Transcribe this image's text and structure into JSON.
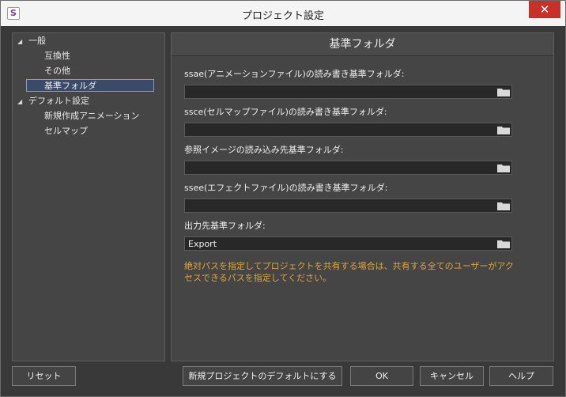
{
  "window": {
    "title": "プロジェクト設定",
    "close_glyph": "✕",
    "app_icon_letter": "S"
  },
  "tree": {
    "items": [
      {
        "label": "一般",
        "expanded_glyph": "◢"
      },
      {
        "label": "互換性"
      },
      {
        "label": "その他"
      },
      {
        "label": "基準フォルダ"
      },
      {
        "label": "デフォルト設定",
        "expanded_glyph": "◢"
      },
      {
        "label": "新規作成アニメーション"
      },
      {
        "label": "セルマップ"
      }
    ]
  },
  "content": {
    "header": "基準フォルダ",
    "fields": [
      {
        "label": "ssae(アニメーションファイル)の読み書き基準フォルダ:",
        "value": ""
      },
      {
        "label": "ssce(セルマップファイル)の読み書き基準フォルダ:",
        "value": ""
      },
      {
        "label": "参照イメージの読み込み先基準フォルダ:",
        "value": ""
      },
      {
        "label": "ssee(エフェクトファイル)の読み書き基準フォルダ:",
        "value": ""
      },
      {
        "label": "出力先基準フォルダ:",
        "value": "Export"
      }
    ],
    "notice": "絶対パスを指定してプロジェクトを共有する場合は、共有する全てのユーザーがアクセスできるパスを指定してください。"
  },
  "buttons": {
    "reset": "リセット",
    "make_default": "新規プロジェクトのデフォルトにする",
    "ok": "OK",
    "cancel": "キャンセル",
    "help": "ヘルプ"
  },
  "colors": {
    "accent_warning": "#e0a43c",
    "selection": "#3b4a66",
    "close": "#c7312a"
  }
}
